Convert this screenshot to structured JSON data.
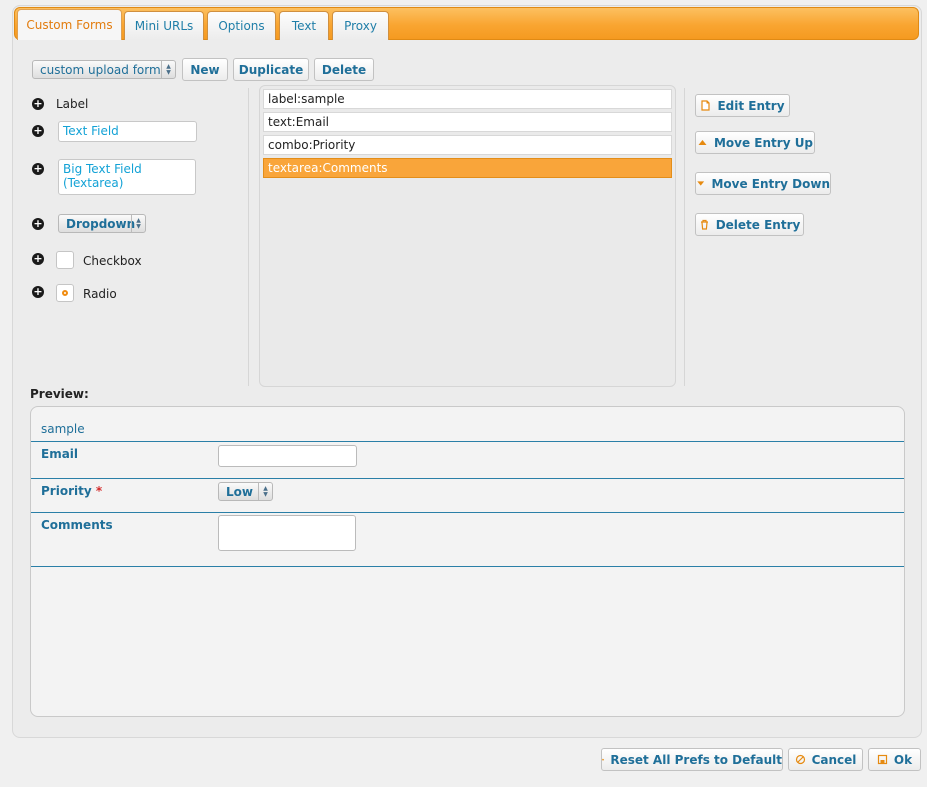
{
  "tabs": [
    "Custom Forms",
    "Mini URLs",
    "Options",
    "Text",
    "Proxy"
  ],
  "toolbar": {
    "form_select": "custom upload form",
    "new_label": "New",
    "duplicate_label": "Duplicate",
    "delete_label": "Delete"
  },
  "palette": {
    "label": "Label",
    "text_field": "Text Field",
    "big_text_field": "Big Text Field (Textarea)",
    "dropdown": "Dropdown",
    "checkbox": "Checkbox",
    "radio": "Radio"
  },
  "entries": [
    "label:sample",
    "text:Email",
    "combo:Priority",
    "textarea:Comments"
  ],
  "selected_entry": "textarea:Comments",
  "actions": {
    "edit": "Edit Entry",
    "move_up": "Move Entry Up",
    "move_down": "Move Entry Down",
    "delete": "Delete Entry"
  },
  "preview": {
    "heading": "Preview:",
    "sample": "sample",
    "email_label": "Email",
    "priority_label": "Priority",
    "required_mark": "*",
    "priority_value": "Low",
    "comments_label": "Comments"
  },
  "footer": {
    "reset": "Reset All Prefs to Default",
    "cancel": "Cancel",
    "ok": "Ok"
  },
  "colors": {
    "accent_orange": "#f9a531",
    "link_blue": "#1f6f99",
    "field_text_blue": "#13a2d6"
  }
}
